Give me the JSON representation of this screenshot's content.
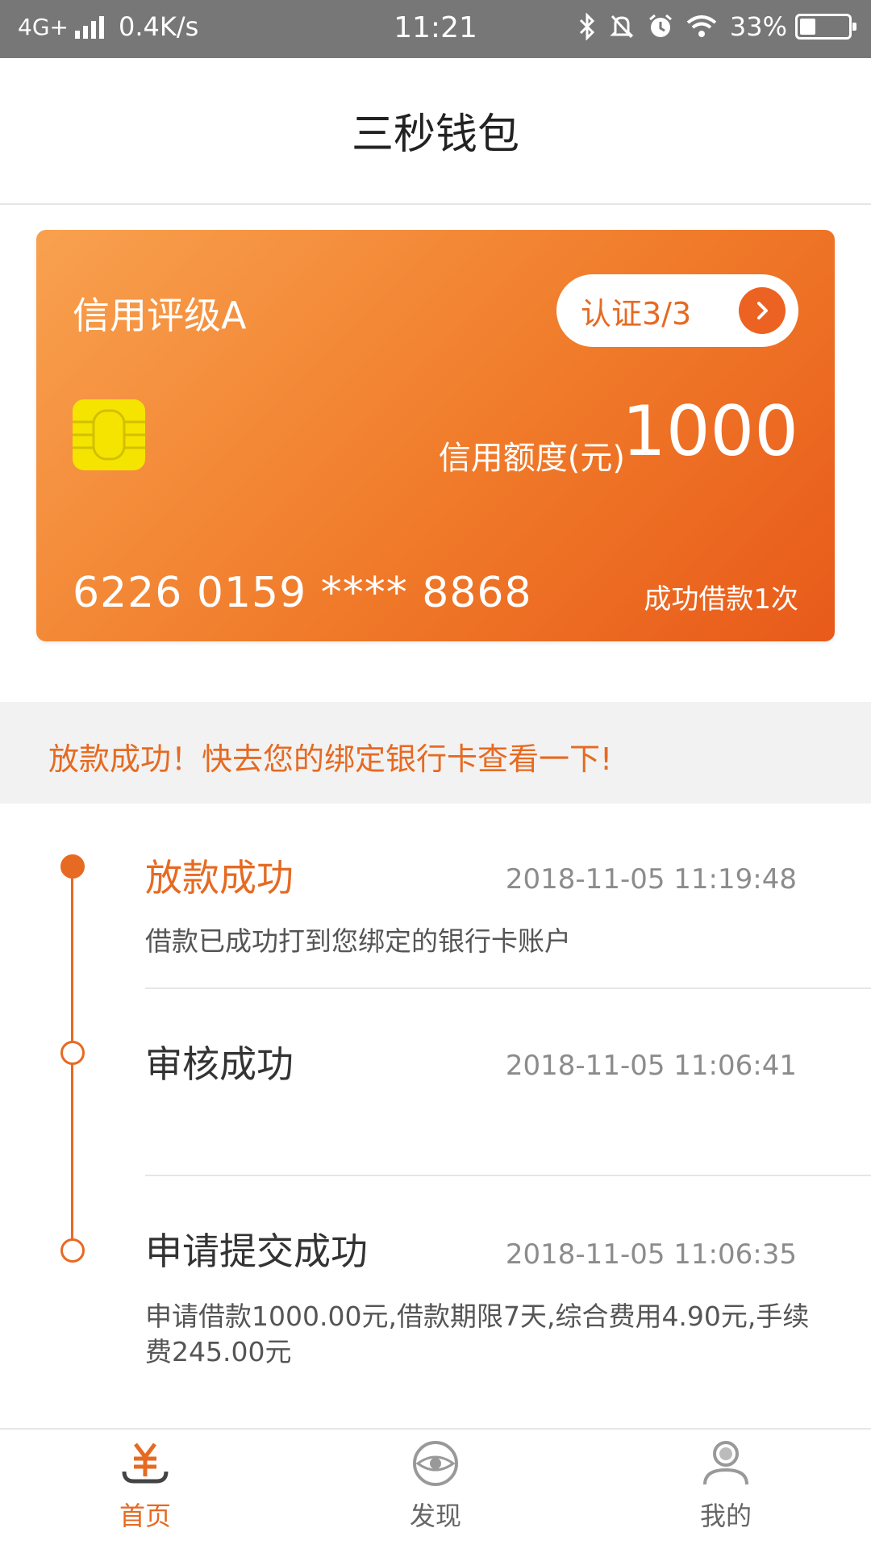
{
  "status_bar": {
    "network": "4G+",
    "speed": "0.4K/s",
    "time": "11:21",
    "battery": "33%",
    "battery_level": 0.33
  },
  "header": {
    "title": "三秒钱包"
  },
  "card": {
    "rating": "信用评级A",
    "verify_label": "认证3/3",
    "limit_label": "信用额度(元)",
    "limit_value": "1000",
    "card_number": "6226 0159 **** 8868",
    "loan_count": "成功借款1次"
  },
  "notice": {
    "text": "放款成功！快去您的绑定银行卡查看一下!"
  },
  "timeline": [
    {
      "title": "放款成功",
      "time": "2018-11-05 11:19:48",
      "desc": "借款已成功打到您绑定的银行卡账户"
    },
    {
      "title": "审核成功",
      "time": "2018-11-05 11:06:41",
      "desc": ""
    },
    {
      "title": "申请提交成功",
      "time": "2018-11-05 11:06:35",
      "desc": "申请借款1000.00元,借款期限7天,综合费用4.90元,手续费245.00元"
    }
  ],
  "nav": [
    {
      "label": "首页",
      "icon": "yuan-icon"
    },
    {
      "label": "发现",
      "icon": "eye-icon"
    },
    {
      "label": "我的",
      "icon": "user-icon"
    }
  ],
  "colors": {
    "accent": "#e66a22",
    "status_bar": "#777777",
    "chip": "#f5e400"
  }
}
